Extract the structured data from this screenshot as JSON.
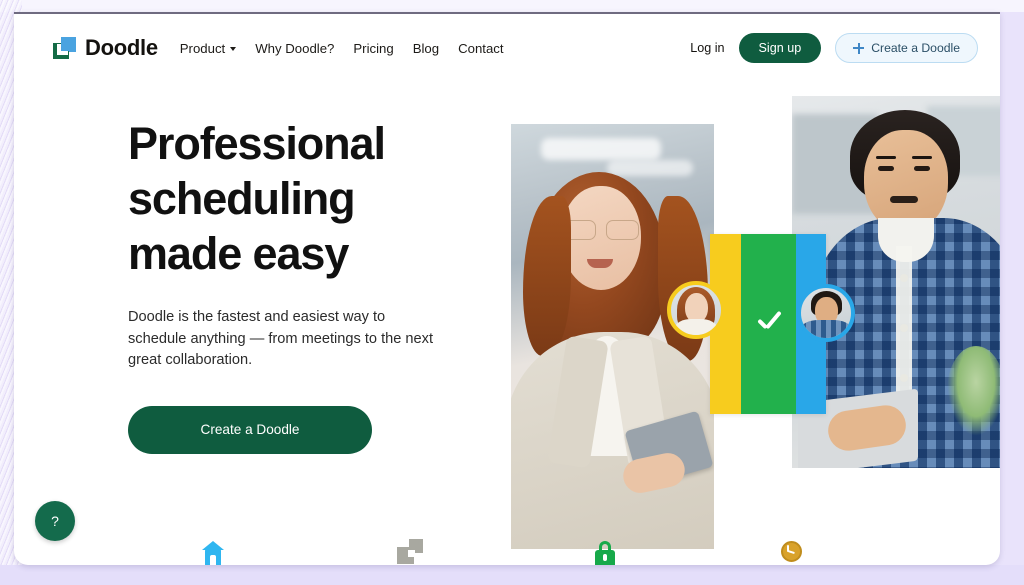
{
  "brand": {
    "name": "Doodle",
    "logo_icon": "doodle-squares-logo"
  },
  "nav": {
    "links": [
      {
        "label": "Product",
        "has_dropdown": true,
        "dropdown_icon": "chevron-down-icon"
      },
      {
        "label": "Why Doodle?",
        "has_dropdown": false
      },
      {
        "label": "Pricing",
        "has_dropdown": false
      },
      {
        "label": "Blog",
        "has_dropdown": false
      },
      {
        "label": "Contact",
        "has_dropdown": false
      }
    ],
    "login_label": "Log in",
    "signup_label": "Sign up",
    "create_label": "Create a Doodle",
    "create_icon": "plus-icon"
  },
  "hero": {
    "heading_line1": "Professional",
    "heading_line2": "scheduling",
    "heading_line3": "made easy",
    "subtitle": "Doodle is the fastest and easiest way to schedule anything — from meetings to the next great collaboration.",
    "cta_label": "Create a Doodle"
  },
  "collage": {
    "left_photo_alt": "woman-with-glasses-holding-tablet",
    "right_photo_alt": "man-in-plaid-shirt-at-laptop",
    "check_icon": "checkmark-icon",
    "avatar_left_alt": "avatar-woman",
    "avatar_right_alt": "avatar-man",
    "bar_colors": [
      "#f7cc1e",
      "#22b14c",
      "#29a7e8"
    ]
  },
  "help": {
    "label": "?",
    "icon": "question-mark-icon"
  },
  "bottom_icons": [
    {
      "name": "home-icon",
      "color": "#2fb6f0"
    },
    {
      "name": "copy-icon",
      "color": "#a8a8a0"
    },
    {
      "name": "lock-icon",
      "color": "#17a94a"
    },
    {
      "name": "clock-icon",
      "color": "#d9a22b"
    }
  ],
  "colors": {
    "brand_green": "#0f5c3f",
    "page_bg": "#ffffff",
    "outer_bg": "#e9e3fb",
    "accent_blue": "#3f87c6"
  }
}
